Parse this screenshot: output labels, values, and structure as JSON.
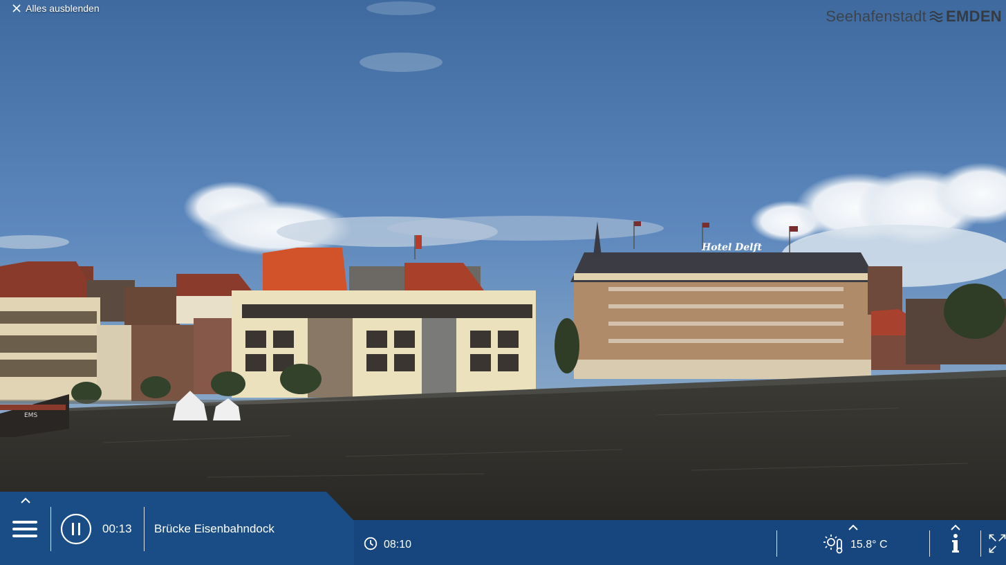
{
  "overlay": {
    "hide_all_label": "Alles ausblenden",
    "brand_light": "Seehafenstadt",
    "brand_bold": "EMDEN"
  },
  "player": {
    "elapsed": "00:13",
    "camera_name": "Brücke Eisenbahndock",
    "clock_time": "08:10",
    "temperature": "15.8° C"
  },
  "scene": {
    "hotel_sign": "Hotel Delft",
    "boat_name": "EMS"
  },
  "icons": [
    "close-icon",
    "wave-logo-icon",
    "menu-icon",
    "pause-icon",
    "clock-icon",
    "weather-icon",
    "info-icon",
    "fullscreen-icon",
    "chevron-up-icon"
  ],
  "colors": {
    "bar_primary": "#1a4d86",
    "bar_secondary": "#17467e",
    "sky": "#3f6fa6",
    "water": "#2c2a25"
  }
}
